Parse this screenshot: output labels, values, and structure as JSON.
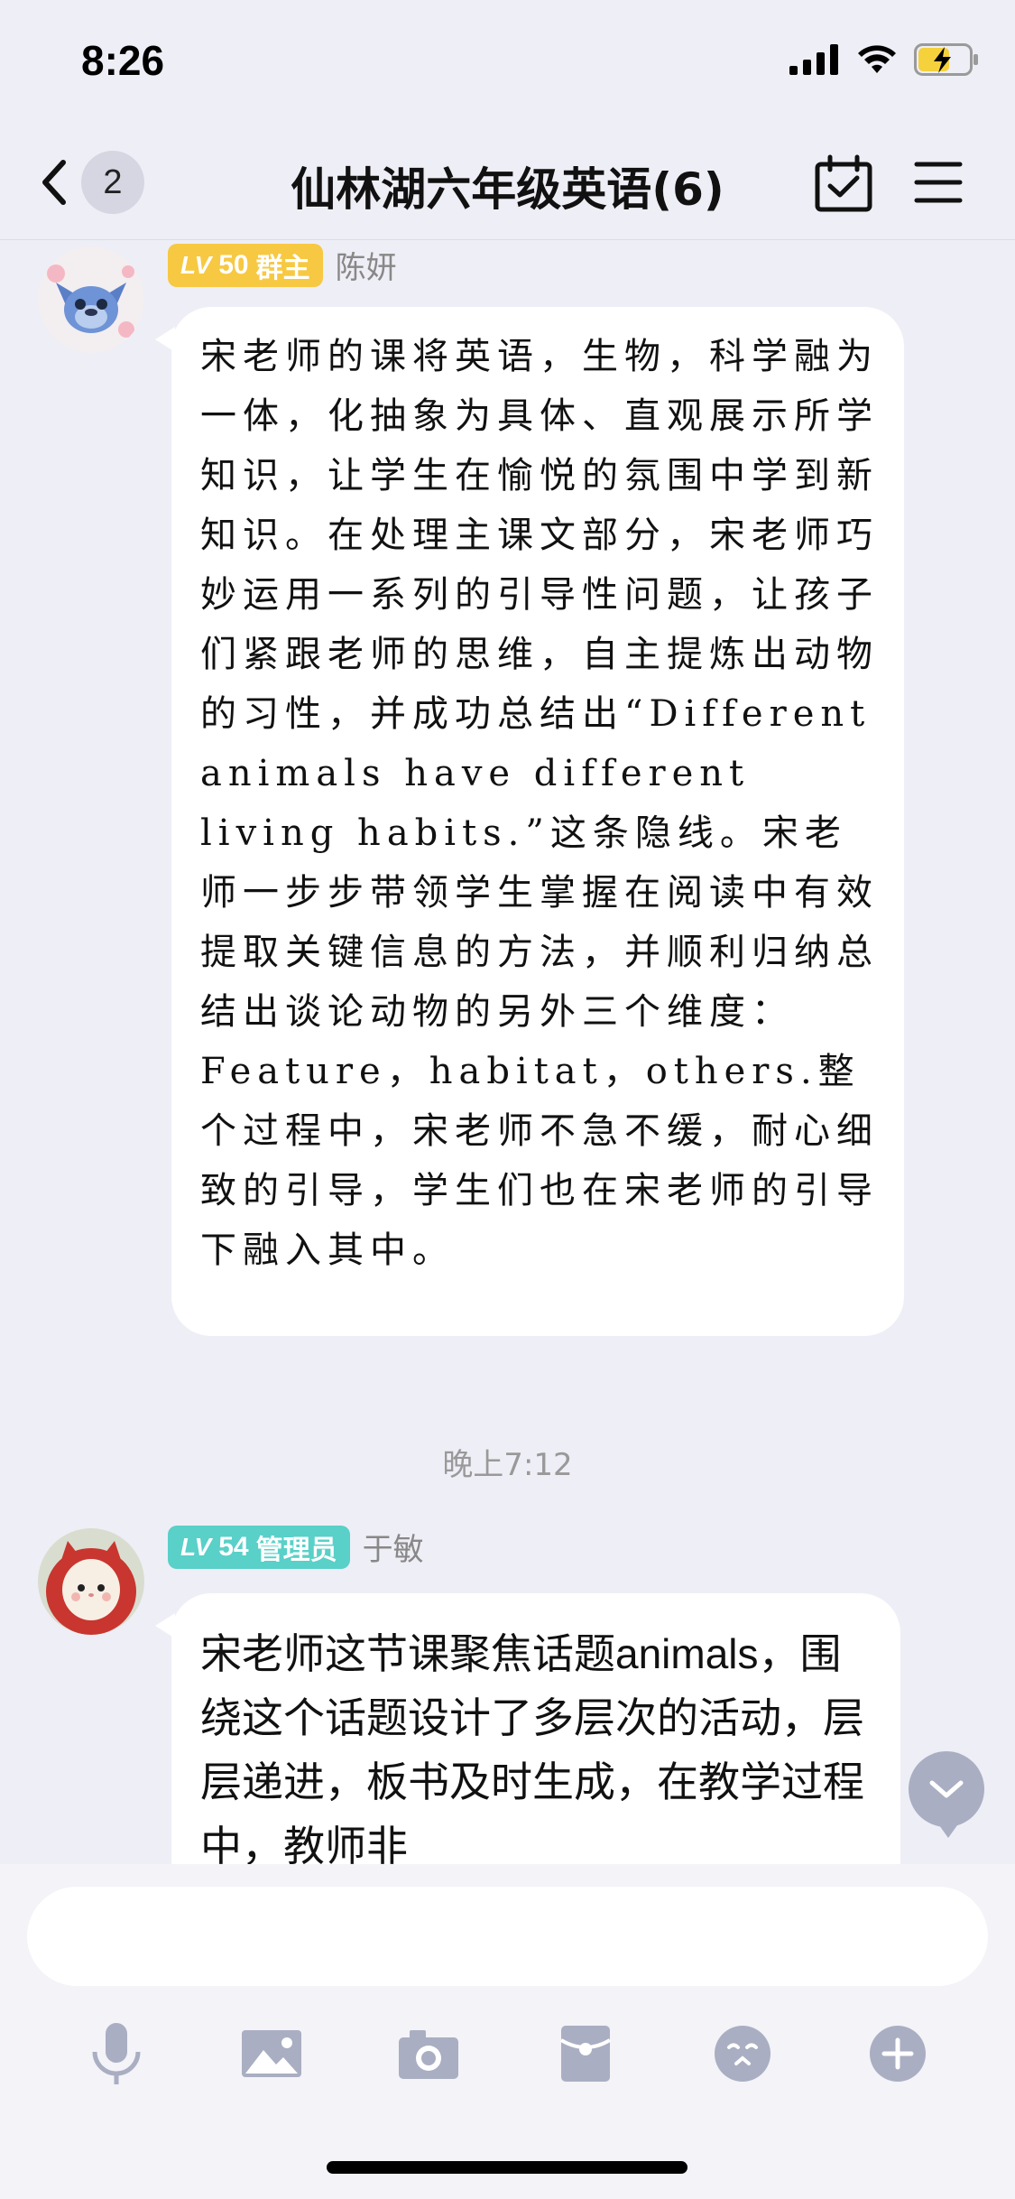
{
  "status_bar": {
    "time": "8:26"
  },
  "nav": {
    "back_count": "2",
    "title": "仙林湖六年级英语(6)"
  },
  "messages": [
    {
      "level": "LV50",
      "level_number": "50",
      "role": "群主",
      "sender": "陈妍",
      "text": "宋老师的课将英语，生物，科学融为一体，化抽象为具体、直观展示所学知识，让学生在愉悦的氛围中学到新知识。在处理主课文部分，宋老师巧妙运用一系列的引导性问题，让孩子们紧跟老师的思维，自主提炼出动物的习性，并成功总结出“Different animals have different living habits.”这条隐线。宋老师一步步带领学生掌握在阅读中有效提取关键信息的方法，并顺利归纳总结出谈论动物的另外三个维度：Feature，habitat，others.整个过程中，宋老师不急不缓，耐心细致的引导，学生们也在宋老师的引导下融入其中。"
    },
    {
      "level": "LV54",
      "level_number": "54",
      "role": "管理员",
      "sender": "于敏",
      "text": "宋老师这节课聚焦话题animals，围绕这个话题设计了多层次的活动，层层递进，板书及时生成，在教学过程中，教师非"
    }
  ],
  "timestamp": "晚上7:12",
  "colors": {
    "background": "#eeeef6",
    "bubble": "#ffffff",
    "gold_badge": "#f7c842",
    "teal_badge": "#59d0c8",
    "icon_gray": "#a9aec2"
  },
  "toolbar_icons": [
    "microphone-icon",
    "image-icon",
    "camera-icon",
    "red-packet-icon",
    "emoji-icon",
    "plus-icon"
  ]
}
